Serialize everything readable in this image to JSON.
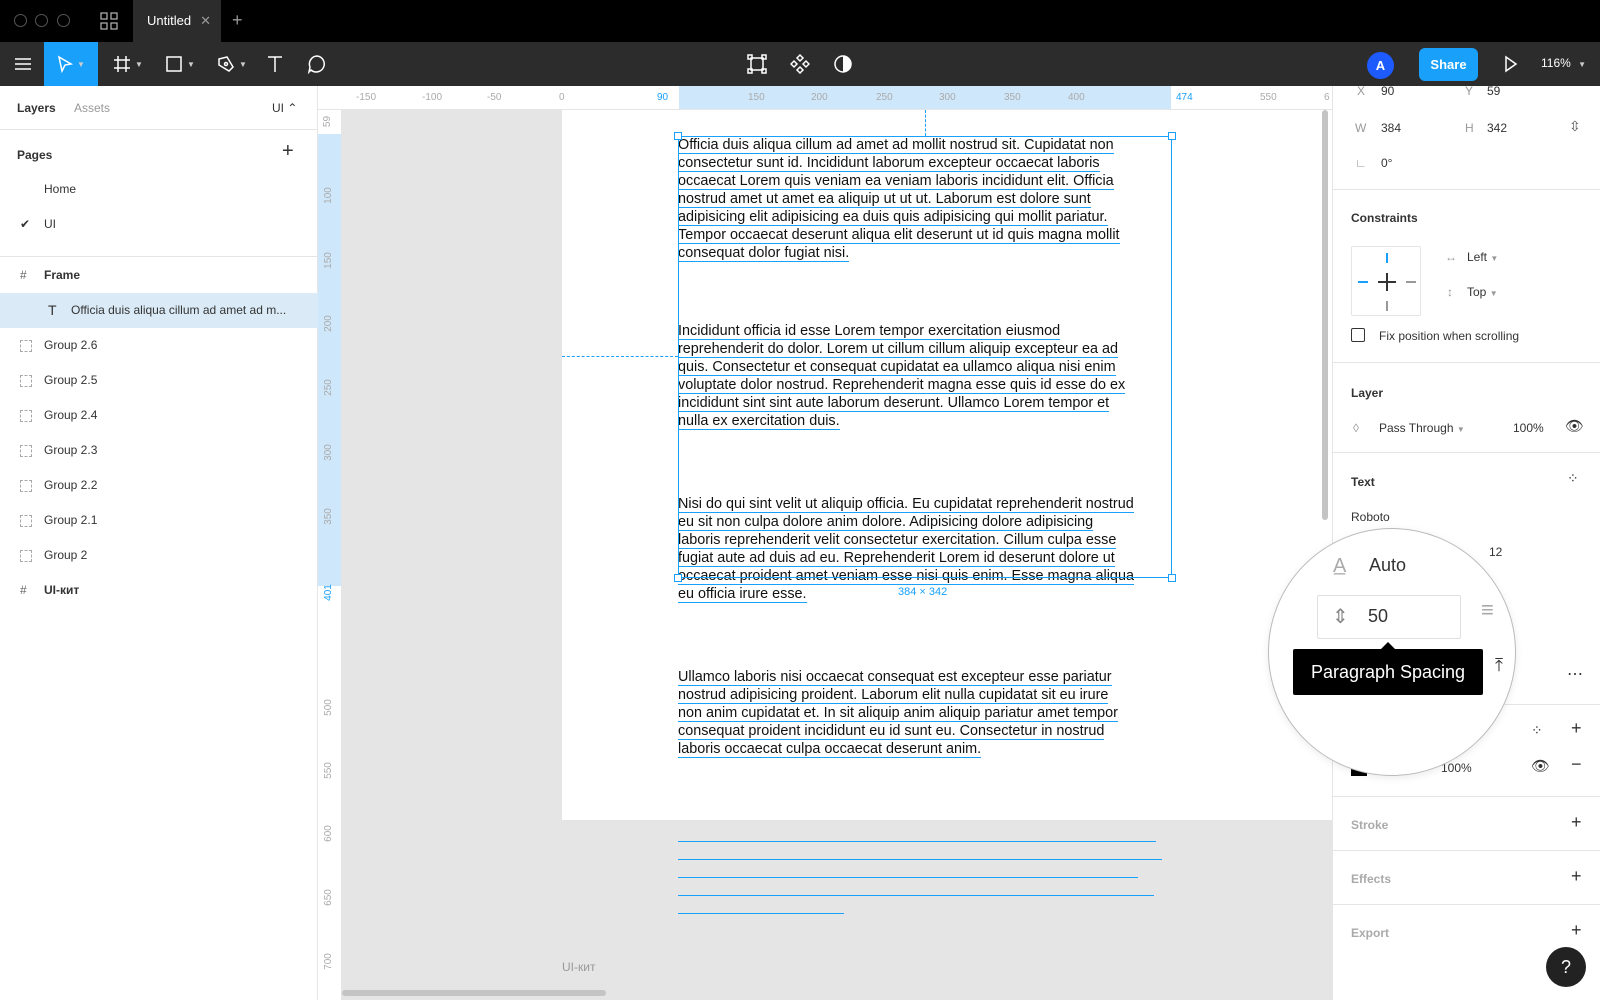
{
  "window": {
    "tab_title": "Untitled",
    "tab_close": "✕",
    "new_tab": "+"
  },
  "toolbar": {
    "share_label": "Share",
    "avatar_initial": "A",
    "zoom": "116%"
  },
  "left_panel": {
    "tabs": {
      "layers": "Layers",
      "assets": "Assets",
      "page_selector": "UI ⌃"
    },
    "pages_title": "Pages",
    "pages_add": "+",
    "pages": [
      {
        "label": "Home",
        "selected": false
      },
      {
        "label": "UI",
        "selected": true
      }
    ],
    "layers": [
      {
        "label": "Frame",
        "type": "frame"
      },
      {
        "label": "Officia duis aliqua cillum ad amet ad m...",
        "type": "text"
      },
      {
        "label": "Group 2.6",
        "type": "group"
      },
      {
        "label": "Group 2.5",
        "type": "group"
      },
      {
        "label": "Group 2.4",
        "type": "group"
      },
      {
        "label": "Group 2.3",
        "type": "group"
      },
      {
        "label": "Group 2.2",
        "type": "group"
      },
      {
        "label": "Group 2.1",
        "type": "group"
      },
      {
        "label": "Group 2",
        "type": "group"
      },
      {
        "label": "UI-кит",
        "type": "frame"
      }
    ]
  },
  "rulers": {
    "top": [
      {
        "label": "-150"
      },
      {
        "label": "-100"
      },
      {
        "label": "-50"
      },
      {
        "label": "0"
      },
      {
        "label": "90",
        "highlight": true
      },
      {
        "label": "150"
      },
      {
        "label": "200"
      },
      {
        "label": "250"
      },
      {
        "label": "300"
      },
      {
        "label": "350"
      },
      {
        "label": "400"
      },
      {
        "label": "474",
        "highlight": true
      },
      {
        "label": "550"
      },
      {
        "label": "6"
      }
    ],
    "left": [
      {
        "label": "59"
      },
      {
        "label": "100"
      },
      {
        "label": "150"
      },
      {
        "label": "200"
      },
      {
        "label": "250"
      },
      {
        "label": "300"
      },
      {
        "label": "350"
      },
      {
        "label": "401",
        "highlight": true
      },
      {
        "label": "500"
      },
      {
        "label": "550"
      },
      {
        "label": "600"
      },
      {
        "label": "650"
      },
      {
        "label": "700"
      }
    ]
  },
  "canvas": {
    "paragraphs": [
      [
        "Officia duis aliqua cillum ad amet ad mollit nostrud sit. Cupidatat non",
        "consectetur sunt id. Incididunt laborum excepteur occaecat laboris",
        "occaecat Lorem quis veniam ea veniam laboris incididunt elit. Officia",
        "nostrud amet ut amet ea aliquip ut ut ut. Laborum est dolore sunt",
        "adipisicing elit adipisicing ea duis quis adipisicing qui mollit pariatur.",
        "Tempor occaecat deserunt aliqua elit deserunt ut id quis magna mollit",
        "consequat dolor fugiat nisi."
      ],
      [
        "Incididunt officia id esse Lorem tempor exercitation eiusmod",
        "reprehenderit do dolor. Lorem ut cillum cillum aliquip excepteur ea ad",
        "quis. Consectetur et consequat cupidatat ea ullamco aliqua nisi enim",
        "voluptate dolor nostrud. Reprehenderit magna esse quis id esse do ex",
        "incididunt sint sint aute laborum deserunt. Ullamco Lorem tempor et",
        "nulla ex exercitation duis."
      ],
      [
        "Nisi do qui sint velit ut aliquip officia. Eu cupidatat reprehenderit nostrud",
        "eu sit non culpa dolore anim dolore. Adipisicing dolore adipisicing",
        "laboris reprehenderit velit consectetur exercitation. Cillum culpa esse",
        "fugiat aute ad duis ad eu. Reprehenderit Lorem id deserunt dolore ut",
        "occaecat proident amet veniam esse nisi quis enim. Esse magna aliqua",
        "eu officia irure esse."
      ],
      [
        "Ullamco laboris nisi occaecat consequat est excepteur esse pariatur",
        "nostrud adipisicing proident. Laborum elit nulla cupidatat sit eu irure",
        "non anim cupidatat et. In sit aliquip anim aliquip pariatur amet tempor",
        "consequat proident incididunt eu id sunt eu. Consectetur in nostrud",
        "laboris occaecat culpa occaecat deserunt anim."
      ]
    ],
    "selection_size": "384 × 342",
    "frame_label": "UI-кит"
  },
  "right_panel": {
    "x_label": "X",
    "x_value": "90",
    "y_label": "Y",
    "y_value": "59",
    "w_label": "W",
    "w_value": "384",
    "h_label": "H",
    "h_value": "342",
    "rotation": "0°",
    "constraints_title": "Constraints",
    "constraint_h": "Left",
    "constraint_v": "Top",
    "fix_position": "Fix position when scrolling",
    "layer_title": "Layer",
    "blend_mode": "Pass Through",
    "layer_opacity": "100%",
    "text_title": "Text",
    "font_family": "Roboto",
    "font_size": "12",
    "fill_hex": "000000",
    "fill_opacity": "100%",
    "stroke_title": "Stroke",
    "effects_title": "Effects",
    "export_title": "Export"
  },
  "magnifier": {
    "line_height": "Auto",
    "paragraph_spacing": "50",
    "tooltip": "Paragraph Spacing"
  },
  "help": "?",
  "colors": {
    "accent": "#18a0fb",
    "toolbar": "#2c2c2c",
    "titlebar": "#000000"
  }
}
